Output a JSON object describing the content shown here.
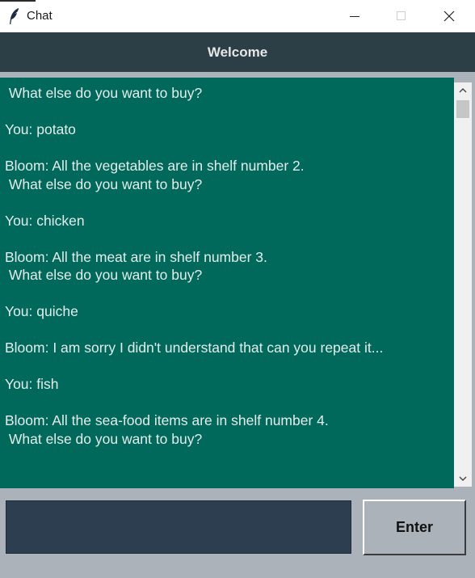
{
  "window": {
    "title": "Chat",
    "icon": "feather-icon",
    "controls": [
      "minimize-icon",
      "maximize-icon",
      "close-icon"
    ]
  },
  "header": {
    "title": "Welcome"
  },
  "chat": {
    "transcript": " What else do you want to buy?\n\nYou: potato\n\nBloom: All the vegetables are in shelf number 2.\n What else do you want to buy?\n\nYou: chicken\n\nBloom: All the meat are in shelf number 3.\n What else do you want to buy?\n\nYou: quiche\n\nBloom: I am sorry I didn't understand that can you repeat it...\n\nYou: fish\n\nBloom: All the sea-food items are in shelf number 4.\n What else do you want to buy?"
  },
  "input": {
    "value": "",
    "placeholder": ""
  },
  "enter_button": {
    "label": "Enter"
  },
  "colors": {
    "chat_background": "#00695c",
    "header_background": "#2c3e46",
    "input_background": "#2c3e50",
    "window_background": "#abb2b9"
  }
}
